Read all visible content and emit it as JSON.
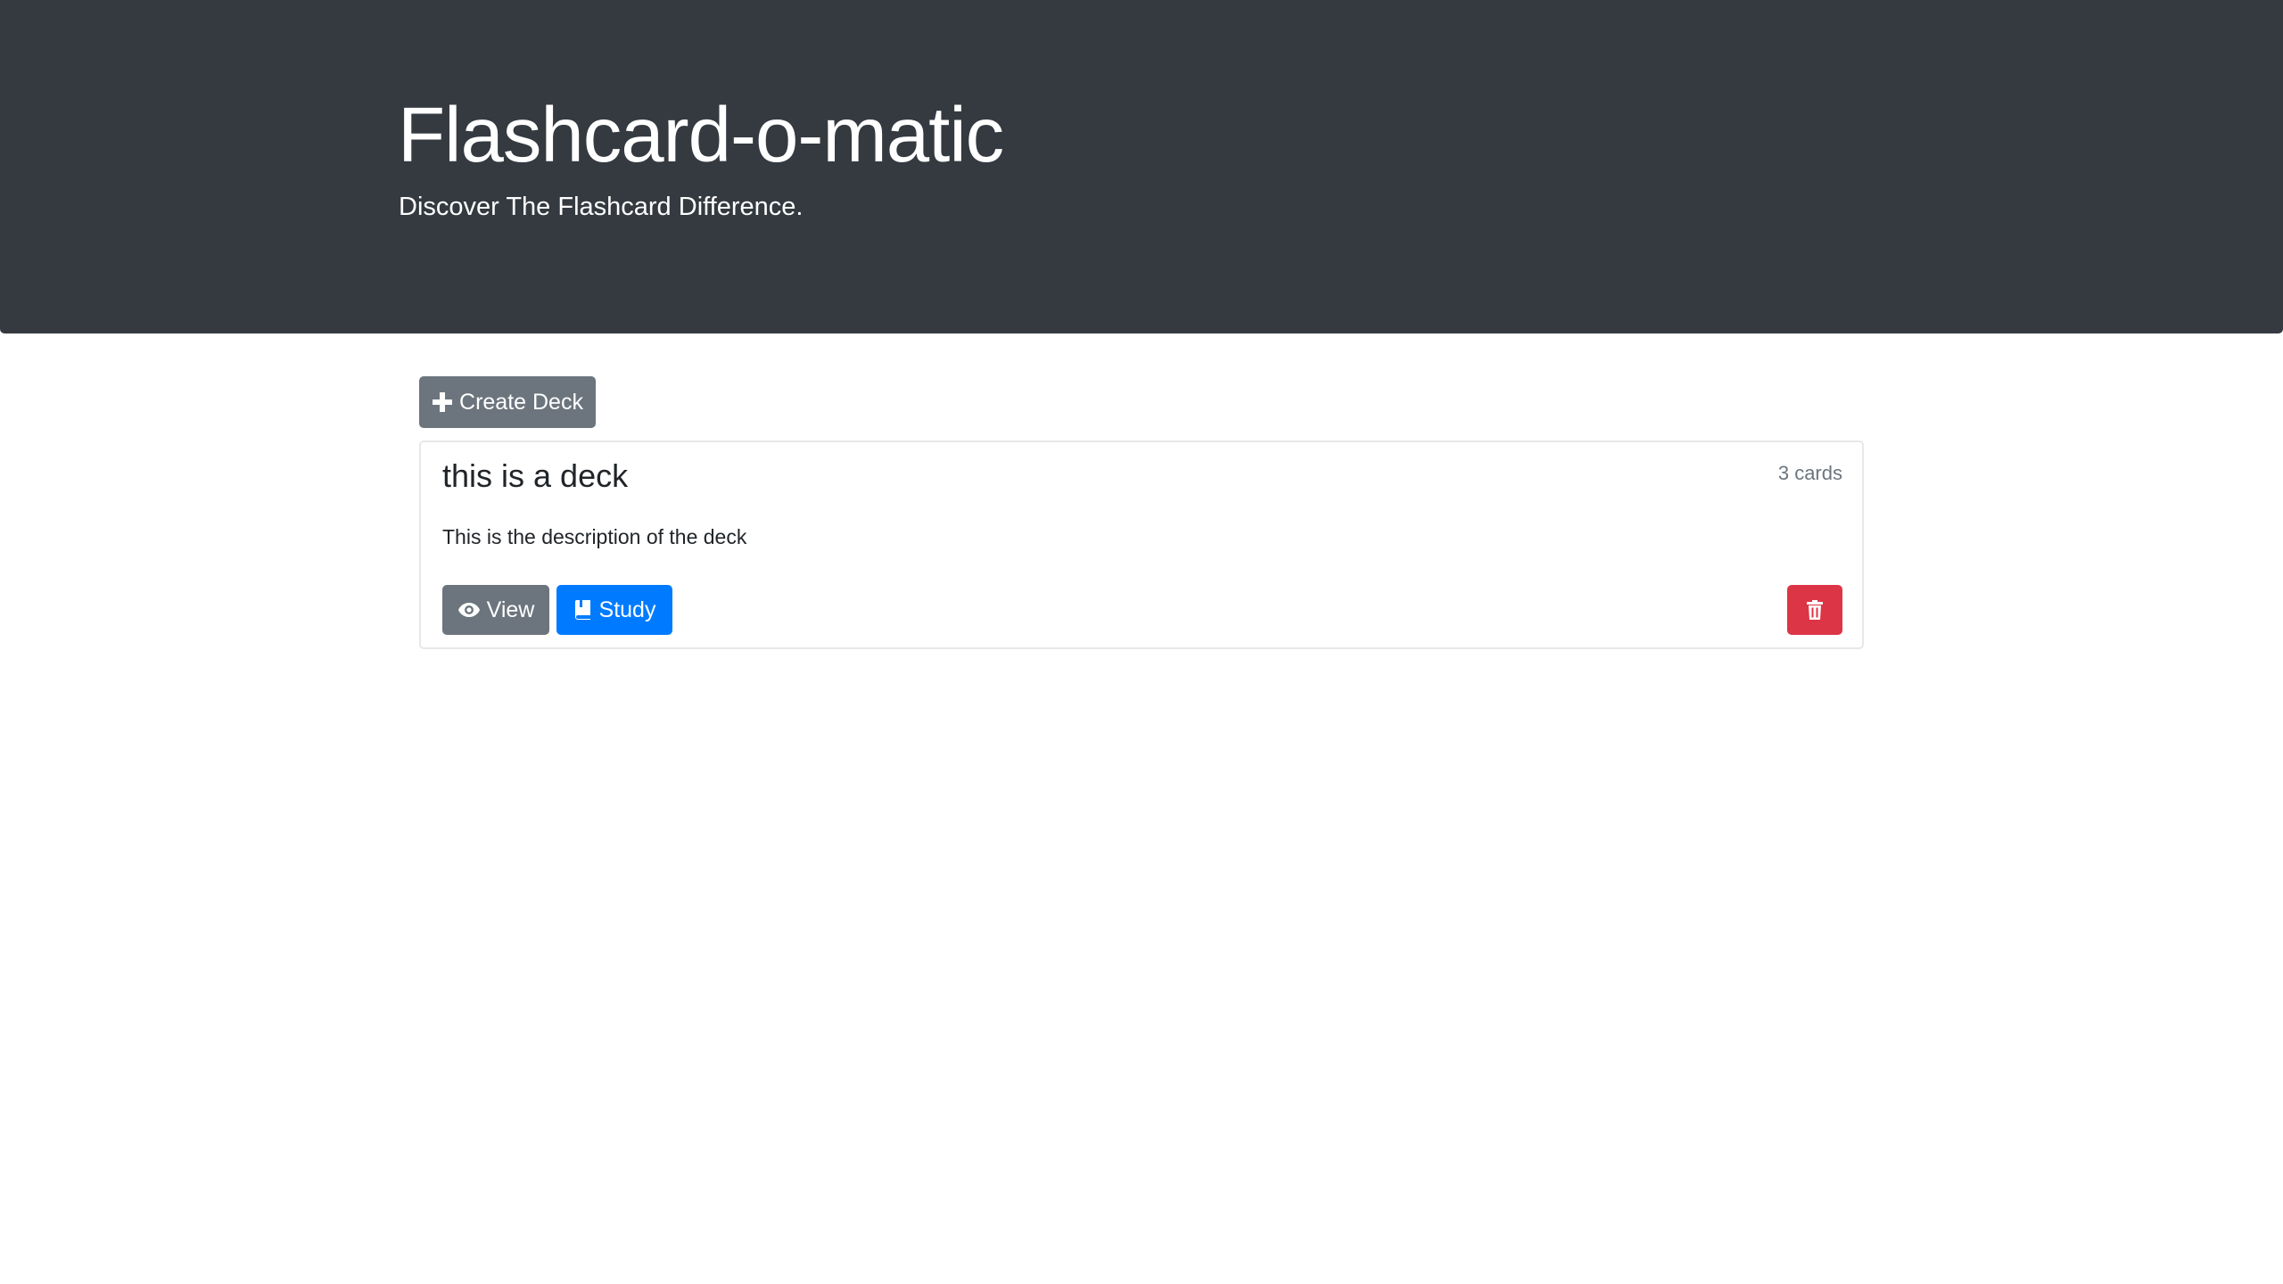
{
  "header": {
    "title": "Flashcard-o-matic",
    "tagline": "Discover The Flashcard Difference."
  },
  "toolbar": {
    "create_label": "Create Deck",
    "create_icon": "plus-icon"
  },
  "decks": [
    {
      "name": "this is a deck",
      "count_label": "3 cards",
      "description": "This is the description of the deck",
      "view_label": "View",
      "view_icon": "eye-icon",
      "study_label": "Study",
      "study_icon": "book-icon",
      "delete_icon": "trash-icon"
    }
  ],
  "colors": {
    "header_bg": "#343a40",
    "secondary": "#6c757d",
    "primary": "#007bff",
    "danger": "#dc3545"
  }
}
